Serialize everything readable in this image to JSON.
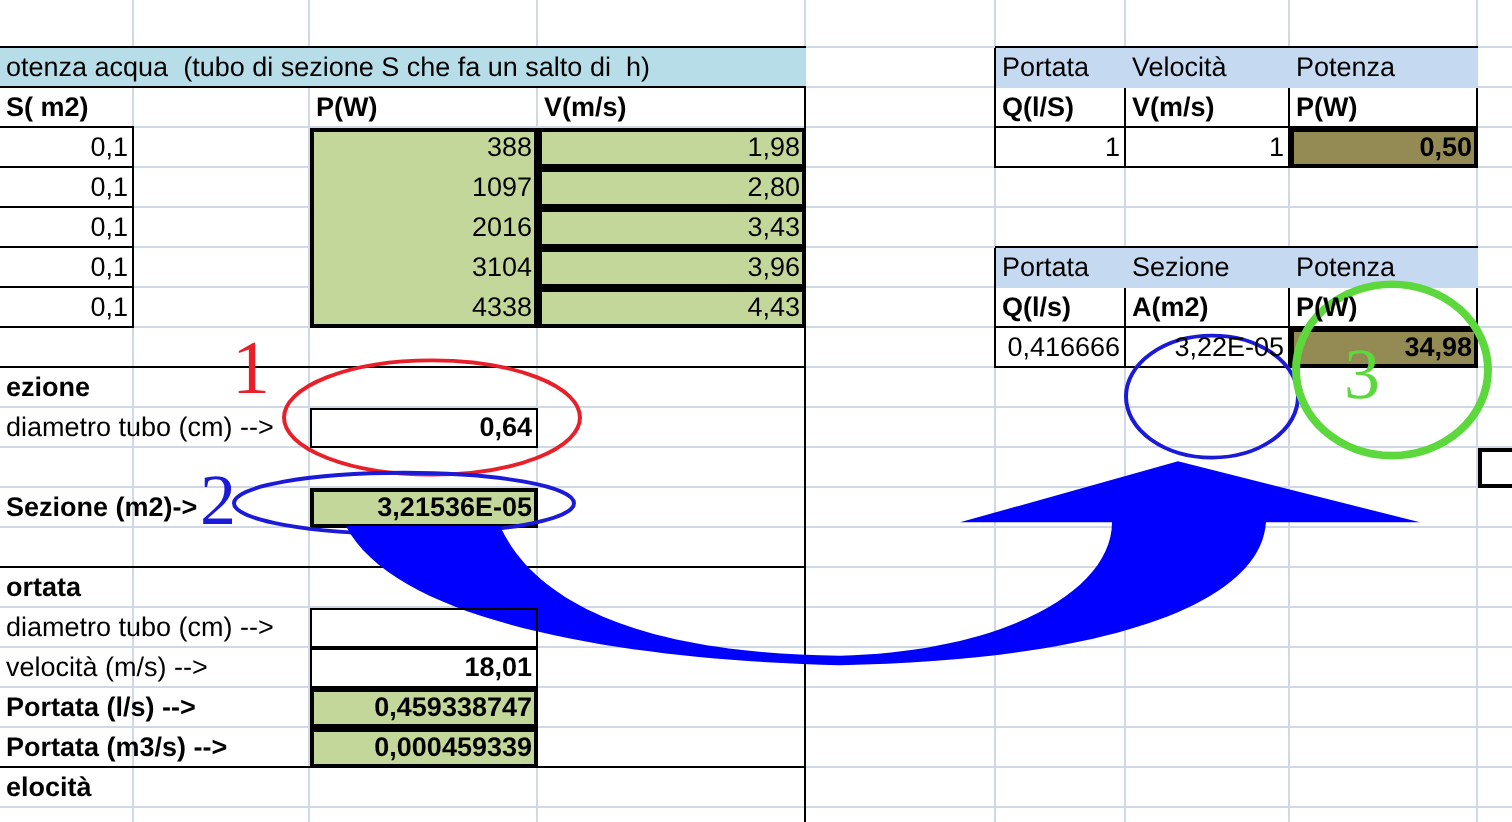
{
  "title": "otenza acqua  (tubo di sezione S che fa un salto di  h)",
  "main_table": {
    "columns": [
      "S( m2)",
      "P(W)",
      "V(m/s)"
    ],
    "rows": [
      {
        "s": "0,1",
        "p": "388",
        "v": "1,98"
      },
      {
        "s": "0,1",
        "p": "1097",
        "v": "2,80"
      },
      {
        "s": "0,1",
        "p": "2016",
        "v": "3,43"
      },
      {
        "s": "0,1",
        "p": "3104",
        "v": "3,96"
      },
      {
        "s": "0,1",
        "p": "4338",
        "v": "4,43"
      }
    ]
  },
  "sections": [
    {
      "heading": "ezione",
      "fields": [
        {
          "kind": "input",
          "label": "diametro tubo (cm) -->",
          "value": "0,64"
        },
        {
          "kind": "spacer"
        },
        {
          "kind": "result",
          "label": "Sezione (m2)->",
          "value": "3,21536E-05"
        },
        {
          "kind": "spacer"
        }
      ]
    },
    {
      "heading": "ortata",
      "fields": [
        {
          "kind": "input",
          "label": "diametro tubo (cm) -->"
        },
        {
          "kind": "input",
          "label": "velocità (m/s) -->",
          "value": "18,01"
        },
        {
          "kind": "result",
          "label": "Portata (l/s) -->",
          "value": "0,459338747"
        },
        {
          "kind": "result",
          "label": "Portata (m3/s) -->",
          "value": "0,000459339"
        }
      ]
    },
    {
      "heading": "elocità"
    }
  ],
  "side_tables": [
    {
      "headers": [
        "Portata",
        "Velocità",
        "Potenza"
      ],
      "units": [
        "Q(l/S)",
        "V(m/s)",
        "P(W)"
      ],
      "values": [
        "1",
        "1",
        "0,50"
      ]
    },
    {
      "headers": [
        "Portata",
        "Sezione",
        "Potenza"
      ],
      "units": [
        "Q(l/s)",
        "A(m2)",
        "P(W)"
      ],
      "values": [
        "0,416666",
        "3,22E-05",
        "34,98"
      ]
    }
  ],
  "active_cell_visible": true,
  "annotations": [
    {
      "kind": "ellipse",
      "label": "1",
      "color": "#e8202a"
    },
    {
      "kind": "ellipse",
      "label": "2",
      "color": "#1a1ad8"
    },
    {
      "kind": "ellipse",
      "color": "#1a1ad8"
    },
    {
      "kind": "ellipse",
      "label": "3",
      "color": "#5cd83c"
    },
    {
      "kind": "arrow",
      "color": "#0000ff"
    }
  ]
}
